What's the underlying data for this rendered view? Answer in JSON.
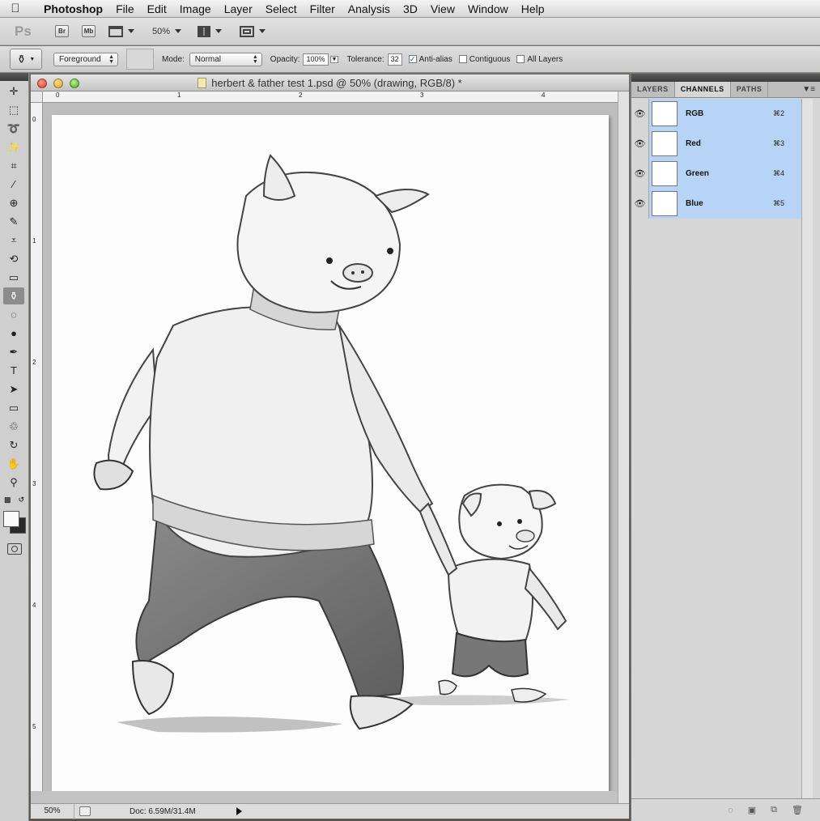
{
  "menubar": {
    "apple": "",
    "app_name": "Photoshop",
    "items": [
      "File",
      "Edit",
      "Image",
      "Layer",
      "Select",
      "Filter",
      "Analysis",
      "3D",
      "View",
      "Window",
      "Help"
    ]
  },
  "appbar": {
    "logo": "Ps",
    "bridge_label": "Br",
    "minibridge_label": "Mb",
    "zoom": "50%"
  },
  "options": {
    "fill_source": "Foreground",
    "mode_label": "Mode:",
    "mode_value": "Normal",
    "opacity_label": "Opacity:",
    "opacity_value": "100%",
    "tolerance_label": "Tolerance:",
    "tolerance_value": "32",
    "antialias_label": "Anti-alias",
    "antialias_checked": true,
    "contiguous_label": "Contiguous",
    "contiguous_checked": false,
    "all_layers_label": "All Layers",
    "all_layers_checked": false
  },
  "tools": [
    {
      "name": "move-tool-icon",
      "glyph": "✛"
    },
    {
      "name": "marquee-tool-icon",
      "glyph": "⬚"
    },
    {
      "name": "lasso-tool-icon",
      "glyph": "➰"
    },
    {
      "name": "quick-select-tool-icon",
      "glyph": "✨"
    },
    {
      "name": "crop-tool-icon",
      "glyph": "⌗"
    },
    {
      "name": "eyedropper-tool-icon",
      "glyph": "∕"
    },
    {
      "name": "healing-brush-tool-icon",
      "glyph": "⊕"
    },
    {
      "name": "brush-tool-icon",
      "glyph": "✎"
    },
    {
      "name": "clone-stamp-tool-icon",
      "glyph": "⩡"
    },
    {
      "name": "history-brush-tool-icon",
      "glyph": "⟲"
    },
    {
      "name": "eraser-tool-icon",
      "glyph": "▭"
    },
    {
      "name": "paint-bucket-tool-icon",
      "glyph": "⚱",
      "active": true
    },
    {
      "name": "blur-tool-icon",
      "glyph": "◌"
    },
    {
      "name": "dodge-tool-icon",
      "glyph": "●"
    },
    {
      "name": "pen-tool-icon",
      "glyph": "✒"
    },
    {
      "name": "type-tool-icon",
      "glyph": "T"
    },
    {
      "name": "path-select-tool-icon",
      "glyph": "➤"
    },
    {
      "name": "shape-tool-icon",
      "glyph": "▭"
    },
    {
      "name": "3d-rotate-tool-icon",
      "glyph": "♲"
    },
    {
      "name": "3d-orbit-tool-icon",
      "glyph": "↻"
    },
    {
      "name": "hand-tool-icon",
      "glyph": "✋"
    },
    {
      "name": "zoom-tool-icon",
      "glyph": "⚲"
    }
  ],
  "colors": {
    "foreground": "#fafafa",
    "background": "#2a2a2a",
    "channel_selected": "#b7d4f7"
  },
  "document": {
    "title": "herbert & father test 1.psd @ 50% (drawing, RGB/8) *",
    "ruler_h": [
      "0",
      "1",
      "2",
      "3",
      "4"
    ],
    "ruler_v": [
      "0",
      "1",
      "2",
      "3",
      "4",
      "5"
    ],
    "status_zoom": "50%",
    "status_doc": "Doc: 6.59M/31.4M"
  },
  "panel": {
    "tabs": [
      "LAYERS",
      "CHANNELS",
      "PATHS"
    ],
    "active_tab": "CHANNELS",
    "channels": [
      {
        "name": "RGB",
        "shortcut": "⌘2"
      },
      {
        "name": "Red",
        "shortcut": "⌘3"
      },
      {
        "name": "Green",
        "shortcut": "⌘4"
      },
      {
        "name": "Blue",
        "shortcut": "⌘5"
      }
    ]
  }
}
